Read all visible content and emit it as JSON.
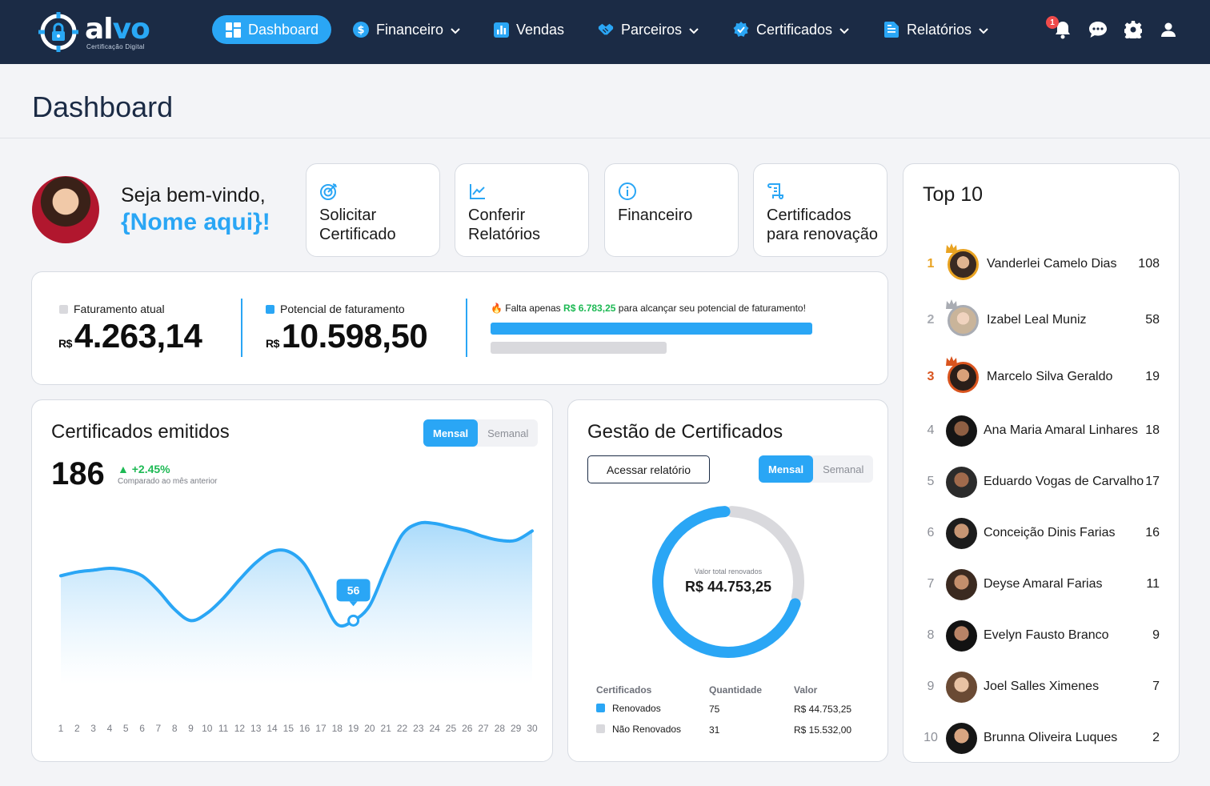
{
  "brand": {
    "name_a": "al",
    "name_b": "vo",
    "tagline": "Certificação Digital"
  },
  "nav": [
    {
      "label": "Dashboard",
      "icon": "dashboard-icon",
      "active": true
    },
    {
      "label": "Financeiro",
      "icon": "dollar-icon"
    },
    {
      "label": "Vendas",
      "icon": "bar-chart-icon"
    },
    {
      "label": "Parceiros",
      "icon": "handshake-icon"
    },
    {
      "label": "Certificados",
      "icon": "badge-check-icon"
    },
    {
      "label": "Relatórios",
      "icon": "document-icon"
    }
  ],
  "notifications": {
    "count": "1"
  },
  "page": {
    "title": "Dashboard"
  },
  "welcome": {
    "line1": "Seja bem-vindo,",
    "line2": "{Nome aqui}!"
  },
  "quick_actions": [
    {
      "line1": "Solicitar",
      "line2": "Certificado",
      "icon": "target-icon"
    },
    {
      "line1": "Conferir",
      "line2": "Relatórios",
      "icon": "trend-icon"
    },
    {
      "line1": "Financeiro",
      "line2": "",
      "icon": "info-icon"
    },
    {
      "line1": "Certificados",
      "line2": "para renovação",
      "icon": "scroll-icon"
    }
  ],
  "revenue": {
    "current_label": "Faturamento atual",
    "current_currency": "R$",
    "current_value": "4.263,14",
    "potential_label": "Potencial de faturamento",
    "potential_currency": "R$",
    "potential_value": "10.598,50",
    "msg_before": "Falta apenas",
    "msg_amount": "R$ 6.783,25",
    "msg_after": "para alcançar seu potencial de faturamento!"
  },
  "issued": {
    "title": "Certificados emitidos",
    "toggle_on": "Mensal",
    "toggle_off": "Semanal",
    "total": "186",
    "delta": "+2.45%",
    "delta_sub": "Comparado ao mês anterior",
    "tooltip": "56"
  },
  "management": {
    "title": "Gestão de Certificados",
    "button": "Acessar relatório",
    "toggle_on": "Mensal",
    "toggle_off": "Semanal",
    "center_label": "Valor total renovados",
    "center_value": "R$ 44.753,25",
    "headers": [
      "Certificados",
      "Quantidade",
      "Valor"
    ],
    "rows": [
      {
        "name": "Renovados",
        "qty": "75",
        "value": "R$ 44.753,25",
        "color": "#2aa6f5"
      },
      {
        "name": "Não Renovados",
        "qty": "31",
        "value": "R$ 15.532,00",
        "color": "#d9d9dd"
      }
    ]
  },
  "top10": {
    "title": "Top 10",
    "entries": [
      {
        "rank": "1",
        "name": "Vanderlei Camelo Dias",
        "score": "108"
      },
      {
        "rank": "2",
        "name": "Izabel Leal Muniz",
        "score": "58"
      },
      {
        "rank": "3",
        "name": "Marcelo Silva Geraldo",
        "score": "19"
      },
      {
        "rank": "4",
        "name": "Ana Maria Amaral Linhares",
        "score": "18"
      },
      {
        "rank": "5",
        "name": "Eduardo Vogas de Carvalho",
        "score": "17"
      },
      {
        "rank": "6",
        "name": "Conceição Dinis Farias",
        "score": "16"
      },
      {
        "rank": "7",
        "name": "Deyse Amaral Farias",
        "score": "11"
      },
      {
        "rank": "8",
        "name": "Evelyn Fausto Branco",
        "score": "9"
      },
      {
        "rank": "9",
        "name": "Joel Salles Ximenes",
        "score": "7"
      },
      {
        "rank": "10",
        "name": "Brunna Oliveira Luques",
        "score": "2"
      }
    ]
  },
  "colors": {
    "navbar": "#1b2b45",
    "accent": "#2aa6f5",
    "positive": "#1db954",
    "gold": "#e9a321",
    "silver": "#a9acb3",
    "bronze": "#d9541e"
  },
  "chart_data": [
    {
      "type": "area",
      "x": [
        "1",
        "2",
        "3",
        "4",
        "5",
        "6",
        "7",
        "8",
        "9",
        "10",
        "11",
        "12",
        "13",
        "14",
        "15",
        "16",
        "17",
        "18",
        "19",
        "20",
        "21",
        "22",
        "23",
        "24",
        "25",
        "26",
        "27",
        "28",
        "29",
        "30"
      ],
      "values": [
        68,
        69,
        69.5,
        70,
        69.5,
        68,
        64,
        59,
        56,
        58,
        62,
        67,
        71.5,
        74.5,
        74.5,
        71,
        63,
        55,
        56,
        60,
        70,
        79,
        82,
        82,
        81,
        80,
        78.5,
        77.5,
        77.5,
        80
      ],
      "highlight": {
        "x": "19",
        "label": "56"
      },
      "ylim": [
        40,
        85
      ],
      "grid": false,
      "legend": "none"
    },
    {
      "type": "pie",
      "style": "donut",
      "labels": [
        "Renovados",
        "Não Renovados"
      ],
      "values": [
        75,
        31
      ],
      "center_label": "Valor total renovados",
      "center_value": "R$ 44.753,25"
    }
  ]
}
